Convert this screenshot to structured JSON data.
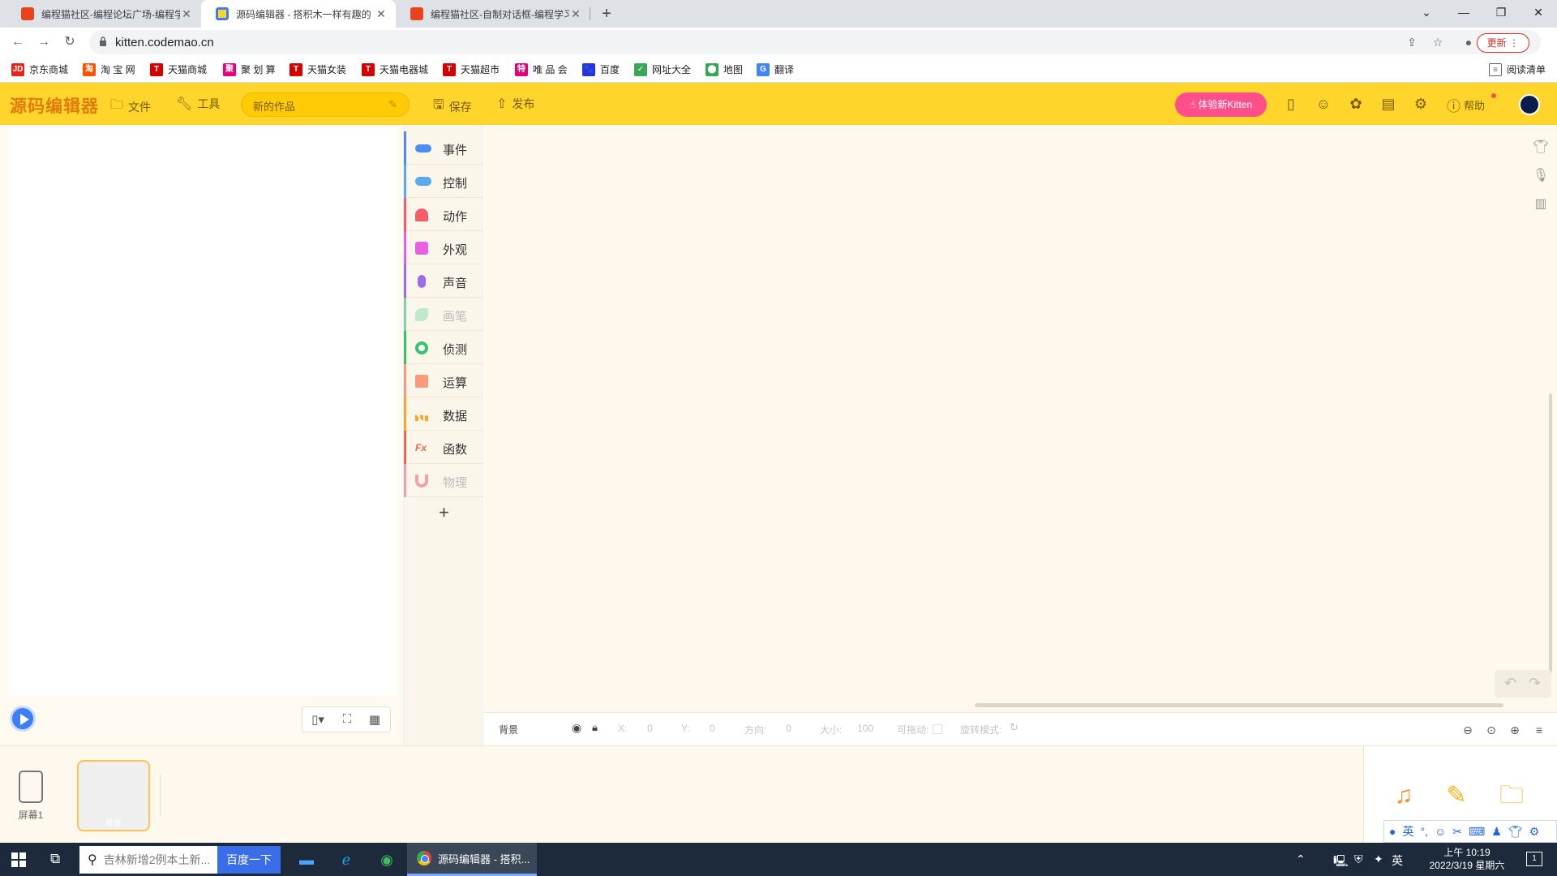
{
  "browser": {
    "tabs": [
      {
        "title": "编程猫社区-编程论坛广场-编程学",
        "active": false
      },
      {
        "title": "源码编辑器 - 搭积木一样有趣的",
        "active": true
      },
      {
        "title": "编程猫社区-自制对话框-编程学习",
        "active": false
      }
    ],
    "new_tab": "+",
    "url": "kitten.codemao.cn",
    "update_label": "更新",
    "reading_list": "阅读清单",
    "bookmarks": [
      {
        "label": "京东商城",
        "icon": "JD",
        "color": "#e1251b"
      },
      {
        "label": "淘 宝 网",
        "icon": "淘",
        "color": "#ff5000"
      },
      {
        "label": "天猫商城",
        "icon": "T",
        "color": "#d40000"
      },
      {
        "label": "聚 划 算",
        "icon": "聚",
        "color": "#e6007a"
      },
      {
        "label": "天猫女装",
        "icon": "T",
        "color": "#d40000"
      },
      {
        "label": "天猫电器城",
        "icon": "T",
        "color": "#d40000"
      },
      {
        "label": "天猫超市",
        "icon": "T",
        "color": "#d40000"
      },
      {
        "label": "唯 品 会",
        "icon": "特",
        "color": "#e6007a"
      },
      {
        "label": "百度",
        "icon": "🐾",
        "color": "#2932e1"
      },
      {
        "label": "网址大全",
        "icon": "✓",
        "color": "#3aa65a"
      },
      {
        "label": "地图",
        "icon": "⬤",
        "color": "#34a853"
      },
      {
        "label": "翻译",
        "icon": "G",
        "color": "#4285f4"
      }
    ]
  },
  "header": {
    "logo": "源码编辑器",
    "file_label": "文件",
    "tools_label": "工具",
    "title_value": "新的作品",
    "save_label": "保存",
    "publish_label": "发布",
    "try_kitten_label": "体验新Kitten",
    "help_label": "帮助"
  },
  "categories": [
    {
      "label": "事件",
      "color": "#4d8bf5",
      "enabled": true
    },
    {
      "label": "控制",
      "color": "#5aa8f0",
      "enabled": true
    },
    {
      "label": "动作",
      "color": "#f35d6a",
      "enabled": true
    },
    {
      "label": "外观",
      "color": "#e85fe0",
      "enabled": true
    },
    {
      "label": "声音",
      "color": "#9b6cf0",
      "enabled": true
    },
    {
      "label": "画笔",
      "color": "#7fd3a0",
      "enabled": false
    },
    {
      "label": "侦测",
      "color": "#35c46a",
      "enabled": true
    },
    {
      "label": "运算",
      "color": "#f79b7a",
      "enabled": true
    },
    {
      "label": "数据",
      "color": "#f7a532",
      "enabled": true
    },
    {
      "label": "函数",
      "color": "#f06848",
      "enabled": true
    },
    {
      "label": "物理",
      "color": "#f0a0a8",
      "enabled": false
    }
  ],
  "add_extension": "+",
  "properties": {
    "sprite_name": "背景",
    "x_label": "X:",
    "x_value": "0",
    "y_label": "Y:",
    "y_value": "0",
    "dir_label": "方向:",
    "dir_value": "0",
    "size_label": "大小:",
    "size_value": "100",
    "drag_label": "可拖动:",
    "rotate_label": "旋转模式:"
  },
  "bottom": {
    "screen_label": "屏幕1",
    "sprite_label": "背景"
  },
  "taskbar": {
    "search_text": "吉林新增2例本土新...",
    "baidu_btn": "百度一下",
    "chrome_task": "源码编辑器 - 搭积...",
    "ime": "英",
    "time": "上午 10:19",
    "date": "2022/3/19 星期六",
    "notif_count": "1"
  }
}
